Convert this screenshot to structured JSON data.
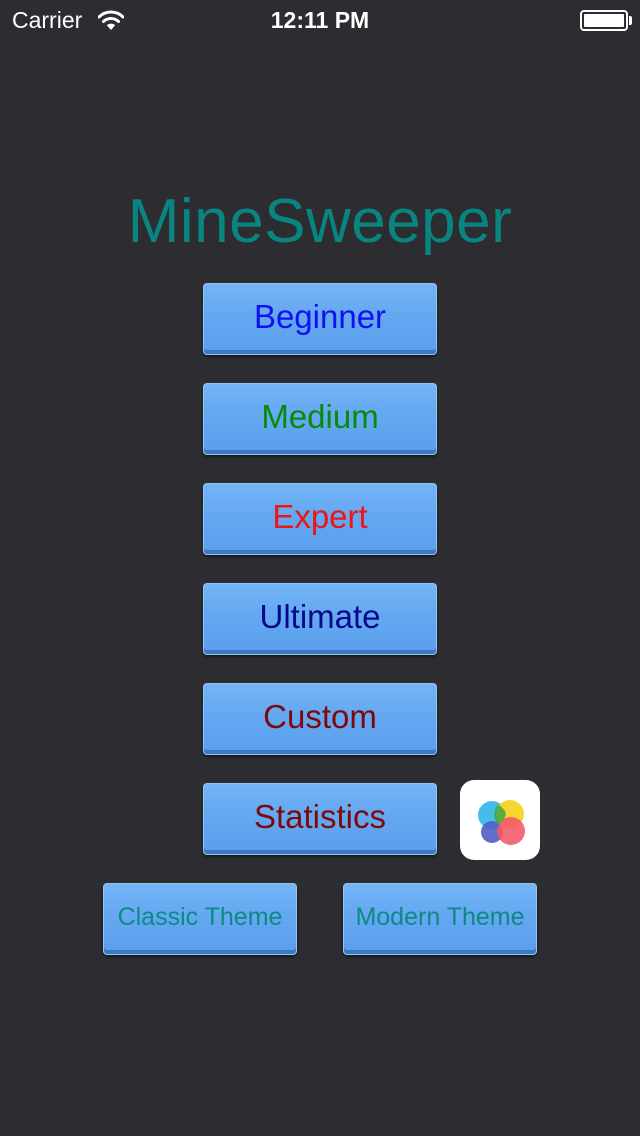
{
  "status_bar": {
    "carrier": "Carrier",
    "time": "12:11 PM",
    "battery_level": 1.0
  },
  "app": {
    "title": "MineSweeper",
    "title_color": "#088580"
  },
  "menu": {
    "beginner": {
      "label": "Beginner",
      "color": "#1010f0"
    },
    "medium": {
      "label": "Medium",
      "color": "#0a8a0a"
    },
    "expert": {
      "label": "Expert",
      "color": "#ee1515"
    },
    "ultimate": {
      "label": "Ultimate",
      "color": "#08088a"
    },
    "custom": {
      "label": "Custom",
      "color": "#7c0a0a"
    },
    "statistics": {
      "label": "Statistics",
      "color": "#7c0a0a"
    }
  },
  "themes": {
    "classic": {
      "label": "Classic Theme"
    },
    "modern": {
      "label": "Modern Theme"
    }
  },
  "icons": {
    "game_center": "game-center-icon",
    "wifi": "wifi-icon",
    "battery": "battery-icon"
  },
  "colors": {
    "background": "#2d2c30",
    "button_face": "#64a8f1",
    "theme_text": "#0e8985"
  }
}
